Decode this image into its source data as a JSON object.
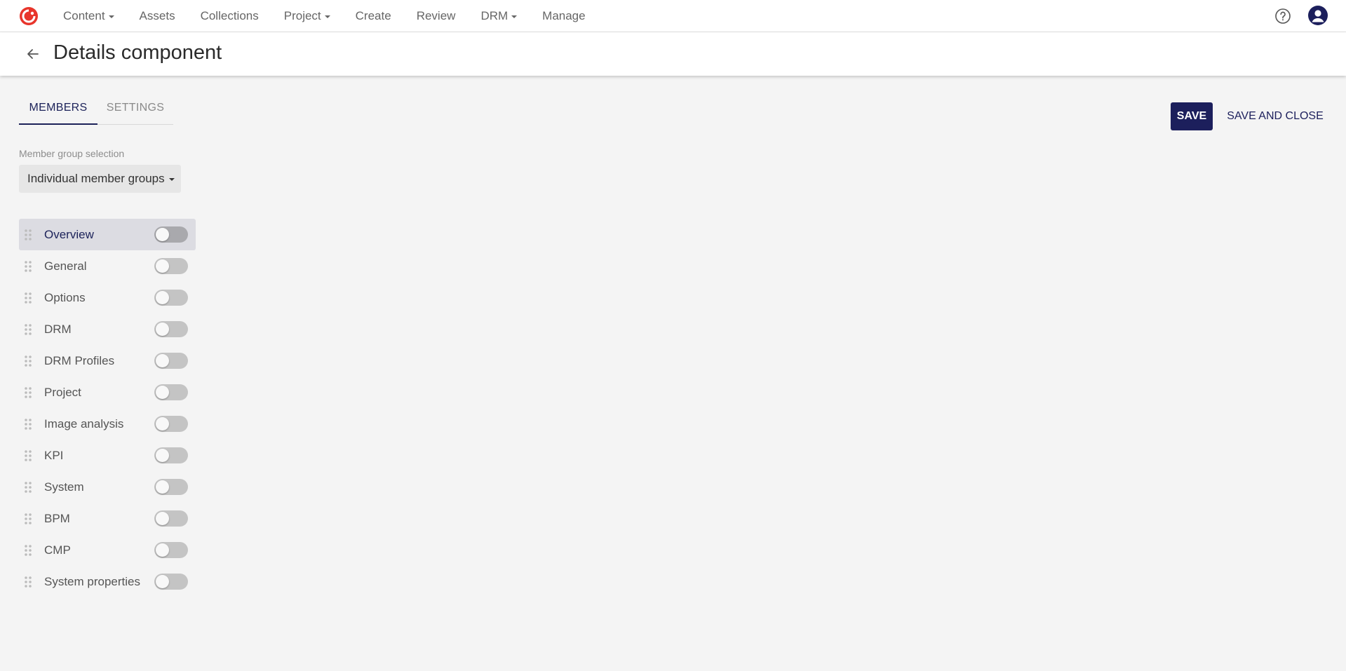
{
  "nav": {
    "items": [
      {
        "label": "Content",
        "dropdown": true
      },
      {
        "label": "Assets",
        "dropdown": false
      },
      {
        "label": "Collections",
        "dropdown": false
      },
      {
        "label": "Project",
        "dropdown": true
      },
      {
        "label": "Create",
        "dropdown": false
      },
      {
        "label": "Review",
        "dropdown": false
      },
      {
        "label": "DRM",
        "dropdown": true
      },
      {
        "label": "Manage",
        "dropdown": false
      }
    ]
  },
  "header": {
    "title": "Details component"
  },
  "tabs": [
    {
      "label": "MEMBERS",
      "active": true
    },
    {
      "label": "SETTINGS",
      "active": false
    }
  ],
  "actions": {
    "save_label": "SAVE",
    "save_close_label": "SAVE AND CLOSE"
  },
  "member_group": {
    "label": "Member group selection",
    "selected": "Individual member groups"
  },
  "members": [
    {
      "label": "Overview",
      "enabled": false,
      "highlighted": true
    },
    {
      "label": "General",
      "enabled": false
    },
    {
      "label": "Options",
      "enabled": false
    },
    {
      "label": "DRM",
      "enabled": false
    },
    {
      "label": "DRM Profiles",
      "enabled": false
    },
    {
      "label": "Project",
      "enabled": false
    },
    {
      "label": "Image analysis",
      "enabled": false
    },
    {
      "label": "KPI",
      "enabled": false
    },
    {
      "label": "System",
      "enabled": false
    },
    {
      "label": "BPM",
      "enabled": false
    },
    {
      "label": "CMP",
      "enabled": false
    },
    {
      "label": "System properties",
      "enabled": false
    }
  ],
  "colors": {
    "accent": "#1c1f5c",
    "logo": "#e8352b",
    "toggle_off": "#c4c4c4"
  },
  "icons": [
    "logo-icon",
    "help-icon",
    "user-icon",
    "back-arrow-icon",
    "drag-handle-icon"
  ]
}
